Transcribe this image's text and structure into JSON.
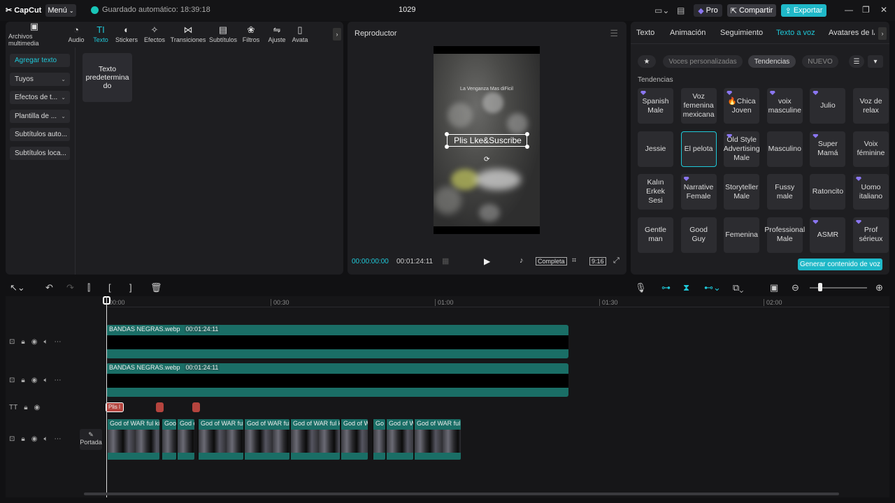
{
  "titlebar": {
    "logo": "CapCut",
    "menu": "Menú",
    "autosave": "Guardado automático: 18:39:18",
    "project": "1029",
    "pro": "Pro",
    "share": "Compartir",
    "export": "Exportar"
  },
  "tools": [
    {
      "icon": "media-icon",
      "glyph": "▣",
      "label": "Archivos multimedia"
    },
    {
      "icon": "audio-icon",
      "glyph": "◔",
      "label": "Audio"
    },
    {
      "icon": "text-icon",
      "glyph": "TI",
      "label": "Texto"
    },
    {
      "icon": "stickers-icon",
      "glyph": "◐",
      "label": "Stickers"
    },
    {
      "icon": "effects-icon",
      "glyph": "✧",
      "label": "Efectos"
    },
    {
      "icon": "transitions-icon",
      "glyph": "⋈",
      "label": "Transiciones"
    },
    {
      "icon": "subtitles-icon",
      "glyph": "▤",
      "label": "Subtítulos"
    },
    {
      "icon": "filters-icon",
      "glyph": "❀",
      "label": "Filtros"
    },
    {
      "icon": "adjust-icon",
      "glyph": "⇋",
      "label": "Ajuste"
    },
    {
      "icon": "avatars-icon",
      "glyph": "▯",
      "label": "Avata"
    }
  ],
  "leftnav": [
    {
      "label": "Agregar texto",
      "chev": ""
    },
    {
      "label": "Tuyos",
      "chev": "⌄"
    },
    {
      "label": "Efectos de t...",
      "chev": "⌄"
    },
    {
      "label": "Plantilla de ...",
      "chev": "⌄"
    },
    {
      "label": "Subtítulos auto...",
      "chev": ""
    },
    {
      "label": "Subtítulos loca...",
      "chev": ""
    }
  ],
  "default_text_card": "Texto predetermina do",
  "player": {
    "title": "Reproductor",
    "video_small_text": "La Venganza Mas diFicil",
    "overlay_text": "Plis Lke&Suscribe",
    "time_current": "00:00:00:00",
    "time_total": "00:01:24:11",
    "complete": "Completa",
    "ratio": "9:16"
  },
  "right": {
    "tabs": [
      "Texto",
      "Animación",
      "Seguimiento",
      "Texto a voz",
      "Avatares de IA"
    ],
    "chips": [
      "Voces personalizadas",
      "Tendencias",
      "NUEVO"
    ],
    "section": "Tendencias",
    "voices": [
      {
        "label": "Spanish Male",
        "gem": true
      },
      {
        "label": "Voz femenina mexicana",
        "gem": false
      },
      {
        "label": "🔥Chica Joven",
        "gem": true
      },
      {
        "label": "voix masculine",
        "gem": true
      },
      {
        "label": "Julio",
        "gem": true
      },
      {
        "label": "Voz de relax",
        "gem": false
      },
      {
        "label": "Jessie",
        "gem": false
      },
      {
        "label": "El pelota",
        "gem": false
      },
      {
        "label": "Old Style Advertising Male",
        "gem": true
      },
      {
        "label": "Masculino",
        "gem": false
      },
      {
        "label": "Super Mamá",
        "gem": true
      },
      {
        "label": "Voix féminine",
        "gem": false
      },
      {
        "label": "Kalın Erkek Sesi",
        "gem": false
      },
      {
        "label": "Narrative Female",
        "gem": true
      },
      {
        "label": "Storyteller Male",
        "gem": false
      },
      {
        "label": "Fussy male",
        "gem": false
      },
      {
        "label": "Ratoncito",
        "gem": false
      },
      {
        "label": "Uomo italiano",
        "gem": true
      },
      {
        "label": "Gentle man",
        "gem": false
      },
      {
        "label": "Good Guy",
        "gem": false
      },
      {
        "label": "Femenina",
        "gem": false
      },
      {
        "label": "Professional Male",
        "gem": false
      },
      {
        "label": "ASMR",
        "gem": true
      },
      {
        "label": "Prof sérieux",
        "gem": true
      }
    ],
    "generate": "Generar contenido de voz"
  },
  "timeline": {
    "ruler": [
      "00:00",
      "00:30",
      "01:00",
      "01:30",
      "02:00"
    ],
    "bands": [
      {
        "name": "BANDAS NEGRAS.webp",
        "dur": "00:01:24:11"
      },
      {
        "name": "BANDAS NEGRAS.webp",
        "dur": "00:01:24:11"
      }
    ],
    "text_clip": "Plis l",
    "cover": "Portada",
    "video_clips": [
      "God of WAR ful ki",
      "Goo",
      "God o",
      "God of WAR ful",
      "God of WAR ful",
      "God of WAR ful k",
      "God of W",
      "Go",
      "God of W",
      "God of WAR ful"
    ]
  },
  "colors": {
    "accent": "#1fc8d8",
    "clip_teal": "#1a6e66",
    "text_clip": "#b5443e",
    "gem": "#8a76f0"
  }
}
